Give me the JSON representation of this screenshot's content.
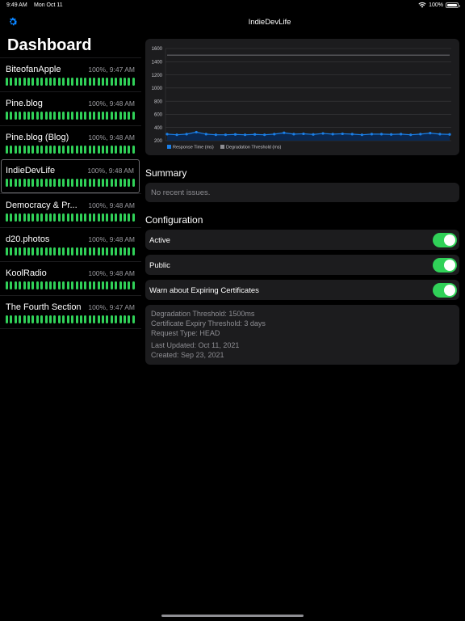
{
  "status_bar": {
    "time": "9:49 AM",
    "date": "Mon Oct 11",
    "battery": "100%"
  },
  "sidebar": {
    "title": "Dashboard",
    "settings_icon": "gear-icon",
    "monitors": [
      {
        "name": "BiteofanApple",
        "status": "100%, 9:47 AM"
      },
      {
        "name": "Pine.blog",
        "status": "100%, 9:48 AM"
      },
      {
        "name": "Pine.blog (Blog)",
        "status": "100%, 9:48 AM"
      },
      {
        "name": "IndieDevLife",
        "status": "100%, 9:48 AM",
        "selected": true
      },
      {
        "name": "Democracy & Pr...",
        "status": "100%, 9:48 AM"
      },
      {
        "name": "d20.photos",
        "status": "100%, 9:48 AM"
      },
      {
        "name": "KoolRadio",
        "status": "100%, 9:48 AM"
      },
      {
        "name": "The Fourth Section",
        "status": "100%, 9:47 AM"
      }
    ],
    "uptime_bar_color": "#30d158"
  },
  "detail": {
    "nav_title": "IndieDevLife",
    "summary_title": "Summary",
    "summary_text": "No recent issues.",
    "config_title": "Configuration",
    "toggles": [
      {
        "label": "Active",
        "on": true
      },
      {
        "label": "Public",
        "on": true
      },
      {
        "label": "Warn about Expiring Certificates",
        "on": true
      }
    ],
    "info": {
      "degradation": "Degradation Threshold: 1500ms",
      "cert_expiry": "Certificate Expiry Threshold: 3 days",
      "request_type": "Request Type: HEAD",
      "last_updated": "Last Updated: Oct 11, 2021",
      "created": "Created: Sep 23, 2021"
    }
  },
  "chart_data": {
    "type": "line",
    "y_ticks": [
      "1600",
      "1400",
      "1200",
      "1000",
      "800",
      "600",
      "400",
      "200"
    ],
    "ylim": [
      200,
      1600
    ],
    "series": [
      {
        "name": "Response Time (ms)",
        "color": "#1a7fe8",
        "values": [
          300,
          290,
          300,
          330,
          300,
          290,
          290,
          295,
          290,
          295,
          290,
          300,
          320,
          300,
          305,
          295,
          310,
          300,
          305,
          300,
          290,
          300,
          300,
          295,
          300,
          290,
          300,
          315,
          300,
          295
        ]
      },
      {
        "name": "Degradation Threshold (ms)",
        "color": "#8e8e93",
        "values": [
          1500,
          1500,
          1500,
          1500,
          1500,
          1500,
          1500,
          1500,
          1500,
          1500,
          1500,
          1500,
          1500,
          1500,
          1500,
          1500,
          1500,
          1500,
          1500,
          1500,
          1500,
          1500,
          1500,
          1500,
          1500,
          1500,
          1500,
          1500,
          1500,
          1500
        ]
      }
    ],
    "legend_position": "bottom-left",
    "grid": true
  }
}
